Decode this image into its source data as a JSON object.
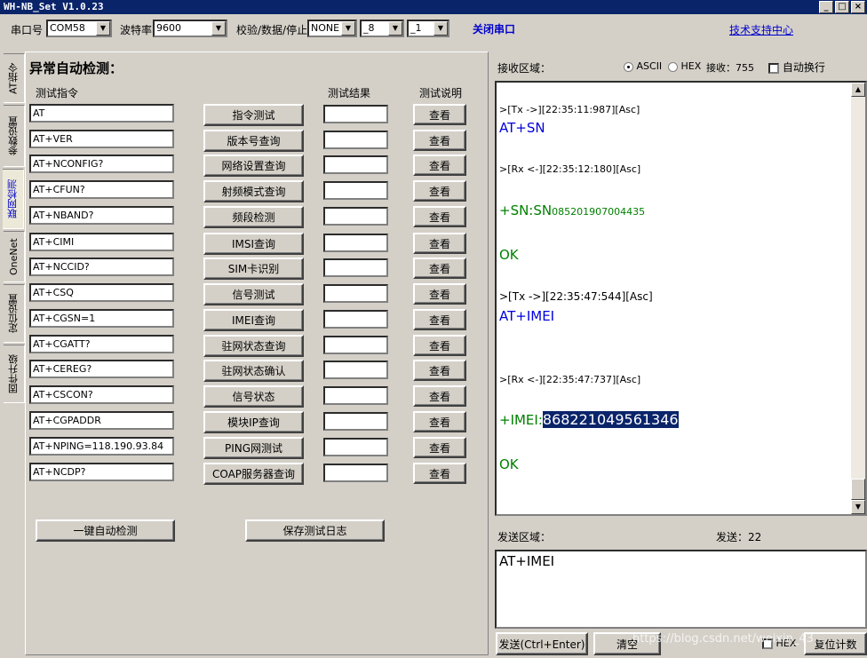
{
  "window": {
    "title": "WH-NB_Set V1.0.23"
  },
  "toolbar": {
    "port_label": "串口号",
    "port_value": "COM58",
    "baud_label": "波特率",
    "baud_value": "9600",
    "parity_label": "校验/数据/停止",
    "parity_value": "NONE",
    "data_value": "_8",
    "stop_value": "_1",
    "close_port": "关闭串口",
    "support": "技术支持中心"
  },
  "tabs": [
    "AT指令",
    "参数设置",
    "联网检测",
    "OneNet",
    "定位设置",
    "固件升级"
  ],
  "main": {
    "title": "异常自动检测：",
    "col_cmd": "测试指令",
    "col_result": "测试结果",
    "col_desc": "测试说明",
    "view_label": "查看",
    "rows": [
      {
        "cmd": "AT",
        "test": "指令测试"
      },
      {
        "cmd": "AT+VER",
        "test": "版本号查询"
      },
      {
        "cmd": "AT+NCONFIG?",
        "test": "网络设置查询"
      },
      {
        "cmd": "AT+CFUN?",
        "test": "射频模式查询"
      },
      {
        "cmd": "AT+NBAND?",
        "test": "频段检测"
      },
      {
        "cmd": "AT+CIMI",
        "test": "IMSI查询"
      },
      {
        "cmd": "AT+NCCID?",
        "test": "SIM卡识别"
      },
      {
        "cmd": "AT+CSQ",
        "test": "信号测试"
      },
      {
        "cmd": "AT+CGSN=1",
        "test": "IMEI查询"
      },
      {
        "cmd": "AT+CGATT?",
        "test": "驻网状态查询"
      },
      {
        "cmd": "AT+CEREG?",
        "test": "驻网状态确认"
      },
      {
        "cmd": "AT+CSCON?",
        "test": "信号状态"
      },
      {
        "cmd": "AT+CGPADDR",
        "test": "模块IP查询"
      },
      {
        "cmd": "AT+NPING=118.190.93.84",
        "test": "PING网测试"
      },
      {
        "cmd": "AT+NCDP?",
        "test": "COAP服务器查询"
      }
    ],
    "auto_btn": "一键自动检测",
    "save_btn": "保存测试日志"
  },
  "rx": {
    "label": "接收区域：",
    "ascii": "ASCII",
    "hex": "HEX",
    "count_label": "接收：",
    "count": "755",
    "wrap": "自动换行",
    "log": {
      "l1": ">[Tx ->][22:35:11:987][Asc]",
      "l2": "AT+SN",
      "l3": ">[Rx <-][22:35:12:180][Asc]",
      "l4a": "+SN:SN",
      "l4b": "085201907004435",
      "l5": "OK",
      "l6": ">[Tx ->][22:35:47:544][Asc]",
      "l7": "AT+IMEI",
      "l8": ">[Rx <-][22:35:47:737][Asc]",
      "l9a": "+IMEI:",
      "l9b": "868221049561346",
      "l10": "OK"
    }
  },
  "tx": {
    "label": "发送区域：",
    "count_label": "发送：",
    "count": "22",
    "content": "AT+IMEI",
    "send_btn": "发送(Ctrl+Enter)",
    "clear_btn": "清空",
    "hex_label": "HEX",
    "reset_btn": "复位计数"
  },
  "watermark": "https://blog.csdn.net/weixin_43..."
}
